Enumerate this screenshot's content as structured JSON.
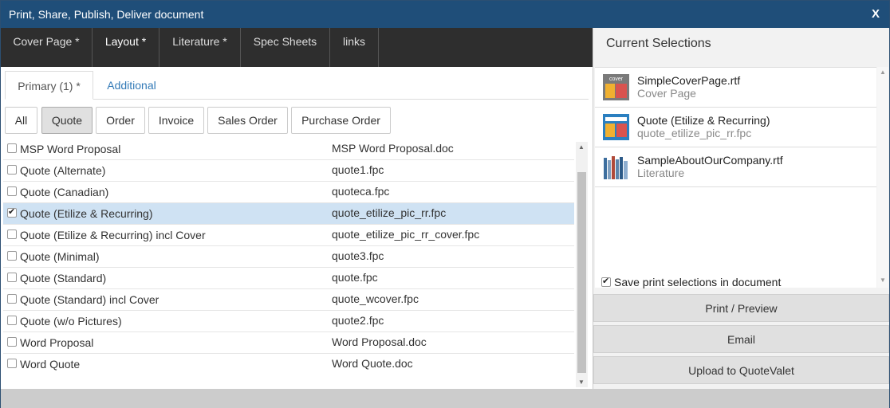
{
  "window": {
    "title": "Print, Share, Publish, Deliver document",
    "close_label": "X"
  },
  "top_tabs": [
    {
      "label": "Cover Page *"
    },
    {
      "label": "Layout *"
    },
    {
      "label": "Literature *"
    },
    {
      "label": "Spec Sheets"
    },
    {
      "label": "links"
    }
  ],
  "sub_tabs": [
    {
      "label": "Primary (1) *"
    },
    {
      "label": "Additional"
    }
  ],
  "filters": [
    {
      "label": "All"
    },
    {
      "label": "Quote"
    },
    {
      "label": "Order"
    },
    {
      "label": "Invoice"
    },
    {
      "label": "Sales Order"
    },
    {
      "label": "Purchase Order"
    }
  ],
  "layouts": [
    {
      "name": "MSP Word Proposal",
      "file": "MSP Word Proposal.doc",
      "checked": false
    },
    {
      "name": "Quote (Alternate)",
      "file": "quote1.fpc",
      "checked": false
    },
    {
      "name": "Quote (Canadian)",
      "file": "quoteca.fpc",
      "checked": false
    },
    {
      "name": "Quote (Etilize & Recurring)",
      "file": "quote_etilize_pic_rr.fpc",
      "checked": true
    },
    {
      "name": "Quote (Etilize & Recurring) incl Cover",
      "file": "quote_etilize_pic_rr_cover.fpc",
      "checked": false
    },
    {
      "name": "Quote (Minimal)",
      "file": "quote3.fpc",
      "checked": false
    },
    {
      "name": "Quote (Standard)",
      "file": "quote.fpc",
      "checked": false
    },
    {
      "name": "Quote (Standard) incl Cover",
      "file": "quote_wcover.fpc",
      "checked": false
    },
    {
      "name": "Quote (w/o Pictures)",
      "file": "quote2.fpc",
      "checked": false
    },
    {
      "name": "Word Proposal",
      "file": "Word Proposal.doc",
      "checked": false
    },
    {
      "name": "Word Quote",
      "file": "Word Quote.doc",
      "checked": false
    }
  ],
  "current_selections": {
    "header": "Current Selections",
    "items": [
      {
        "title": "SimpleCoverPage.rtf",
        "subtitle": "Cover Page",
        "icon": "cover-page-icon",
        "icon_text": "cover"
      },
      {
        "title": "Quote (Etilize & Recurring)",
        "subtitle": "quote_etilize_pic_rr.fpc",
        "icon": "layout-icon"
      },
      {
        "title": "SampleAboutOurCompany.rtf",
        "subtitle": "Literature",
        "icon": "literature-books-icon"
      }
    ],
    "save_option": "Save print selections in document"
  },
  "actions": {
    "print_preview": "Print / Preview",
    "email": "Email",
    "upload": "Upload to QuoteValet"
  },
  "colors": {
    "title_bar": "#1f4e79",
    "nav_bar": "#2e2e2e",
    "selected_row": "#cfe2f3",
    "link": "#337ab7"
  }
}
